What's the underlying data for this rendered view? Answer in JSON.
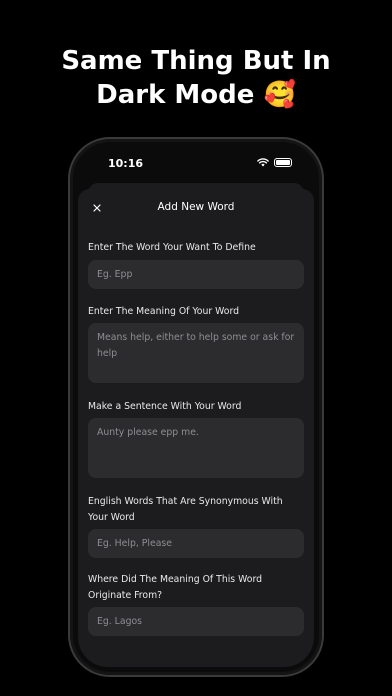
{
  "headline": {
    "line1": "Same Thing But In",
    "line2": "Dark Mode 🥰"
  },
  "status_bar": {
    "time": "10:16"
  },
  "sheet": {
    "title": "Add New Word",
    "close_icon": "close-icon"
  },
  "fields": [
    {
      "label": "Enter The Word Your Want To Define",
      "placeholder": "Eg. Epp"
    },
    {
      "label": "Enter The Meaning Of Your Word",
      "placeholder": "Means help, either to help some or ask for help"
    },
    {
      "label": "Make a Sentence With Your Word",
      "placeholder": "Aunty please epp me."
    },
    {
      "label": "English Words That Are Synonymous With Your Word",
      "placeholder": "Eg. Help, Please"
    },
    {
      "label": "Where Did The Meaning Of This Word Originate From?",
      "placeholder": "Eg. Lagos"
    }
  ],
  "colors": {
    "background": "#000000",
    "sheet": "#1c1c1e",
    "field": "#2c2c2e",
    "placeholder": "#8e8e93",
    "text": "#ffffff"
  }
}
